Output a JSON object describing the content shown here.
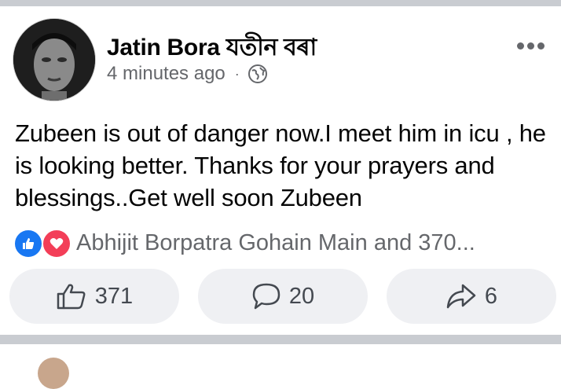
{
  "post": {
    "author": "Jatin Bora যতীন বৰা",
    "timestamp": "4 minutes ago",
    "separator": "·",
    "privacy_icon": "globe-icon",
    "more_icon": "more-options-icon",
    "text": "Zubeen is out of danger now.I meet him in icu , he is looking better. Thanks for your prayers and blessings..Get well soon Zubeen"
  },
  "reactions": {
    "types": [
      "like",
      "love"
    ],
    "summary": "Abhijit Borpatra Gohain Main and 370..."
  },
  "actions": {
    "like_count": "371",
    "comment_count": "20",
    "share_count": "6"
  },
  "colors": {
    "like_blue": "#1877f2",
    "love_red": "#f33e58",
    "secondary_text": "#65676b",
    "separator": "#c9ccd1",
    "button_bg": "#eff0f3"
  }
}
